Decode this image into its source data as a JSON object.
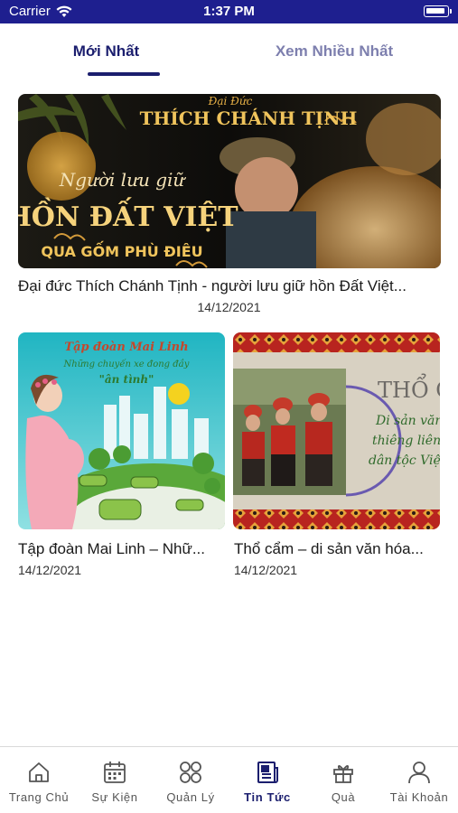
{
  "status_bar": {
    "carrier": "Carrier",
    "time": "1:37 PM"
  },
  "tabs": [
    {
      "label": "Mới Nhất",
      "active": true
    },
    {
      "label": "Xem Nhiều Nhất",
      "active": false
    }
  ],
  "featured": {
    "title": "Đại đức Thích Chánh Tịnh - người lưu giữ hồn Đất Việt...",
    "date": "14/12/2021",
    "image_text": {
      "honorific": "Đại Đức",
      "name": "THÍCH CHÁNH TỊNH",
      "line1": "Người lưu giữ",
      "line2": "HỒN ĐẤT VIỆT",
      "line3": "QUA GỐM PHÙ ĐIÊU"
    }
  },
  "articles": [
    {
      "title": "Tập đoàn Mai Linh – Nhữ...",
      "date": "14/12/2021",
      "image_text": {
        "line1": "Tập đoàn Mai Linh",
        "line2": "Những chuyến xe đong đầy",
        "line3": "\"ân tình\""
      }
    },
    {
      "title": "Thổ cẩm – di sản văn hóa...",
      "date": "14/12/2021",
      "image_text": {
        "heading": "THỔ C",
        "line1": "Di sản văn",
        "line2": "thiêng liên",
        "line3": "dân tộc Việ"
      }
    }
  ],
  "bottom_nav": [
    {
      "label": "Trang Chủ",
      "icon": "home-icon",
      "active": false
    },
    {
      "label": "Sự Kiện",
      "icon": "calendar-icon",
      "active": false
    },
    {
      "label": "Quản Lý",
      "icon": "grid-circles-icon",
      "active": false
    },
    {
      "label": "Tin Tức",
      "icon": "newspaper-icon",
      "active": true
    },
    {
      "label": "Quà",
      "icon": "gift-icon",
      "active": false
    },
    {
      "label": "Tài Khoản",
      "icon": "user-icon",
      "active": false
    }
  ],
  "colors": {
    "primary": "#1b1e6e",
    "status_bar": "#1e1f8f",
    "inactive_tab": "#7d7fae"
  }
}
